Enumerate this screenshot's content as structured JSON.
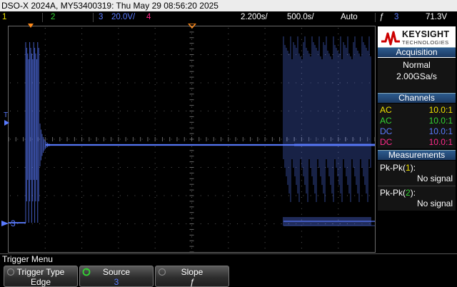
{
  "title_bar": {
    "text": "DSO-X 2024A, MY53400319: Thu May 29 08:56:20 2025"
  },
  "status_bar": {
    "ch1_num": "1",
    "ch2_num": "2",
    "ch3_num": "3",
    "ch3_scale": "20.0V/",
    "ch4_num": "4",
    "time_scale": "2.200s/",
    "sample_rate": "500.0s/",
    "trigger_mode": "Auto",
    "trigger_source": "3",
    "trigger_level": "71.3V"
  },
  "grid": {
    "ch3_marker": "3",
    "trigger_marker": "T"
  },
  "side_panel": {
    "logo_name": "KEYSIGHT",
    "logo_sub": "TECHNOLOGIES",
    "acquisition": {
      "title": "Acquisition",
      "mode": "Normal",
      "rate": "2.00GSa/s"
    },
    "channels": {
      "title": "Channels",
      "rows": [
        {
          "coupling": "AC",
          "probe": "10.0:1",
          "color": "#f0e200"
        },
        {
          "coupling": "AC",
          "probe": "10.0:1",
          "color": "#33d433"
        },
        {
          "coupling": "DC",
          "probe": "10.0:1",
          "color": "#5a7bff"
        },
        {
          "coupling": "DC",
          "probe": "10.0:1",
          "color": "#ff2a8a"
        }
      ]
    },
    "measurements": {
      "title": "Measurements",
      "items": [
        {
          "label": "Pk-Pk",
          "channel": "1",
          "value": "No signal"
        },
        {
          "label": "Pk-Pk",
          "channel": "2",
          "value": "No signal"
        }
      ]
    }
  },
  "menu": {
    "title": "Trigger Menu",
    "softkeys": [
      {
        "top": "Trigger Type",
        "bottom": "Edge"
      },
      {
        "top": "Source",
        "bottom": "3"
      },
      {
        "top": "Slope",
        "bottom": "ƒ"
      }
    ]
  },
  "colors": {
    "ch1": "#f0e200",
    "ch2": "#33d433",
    "ch3": "#5a7bff",
    "ch4": "#ff2a8a",
    "accent": "#ff8a1a",
    "logo_red": "#cc0000"
  }
}
